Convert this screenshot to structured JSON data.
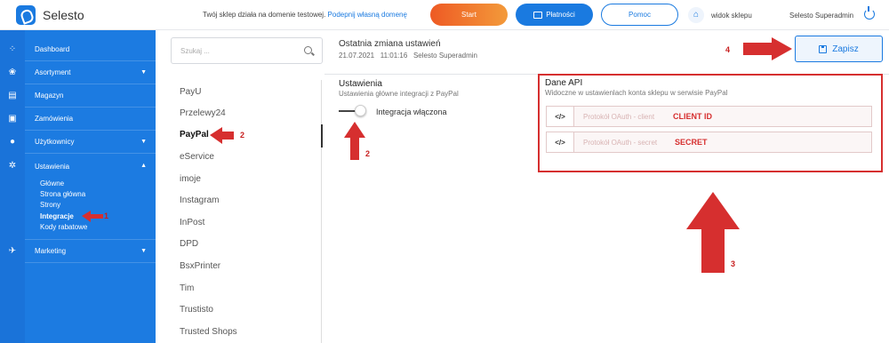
{
  "app": {
    "name": "Selesto",
    "notice": "Twój sklep działa na domenie testowej.",
    "notice_link": "Podepnij własną domenę"
  },
  "topbar": {
    "start_label": "Start",
    "payments_label": "Płatności",
    "help_label": "Pomoc",
    "view_shop_label": "widok sklepu",
    "user_label": "Selesto Superadmin"
  },
  "sidebar": {
    "items": [
      {
        "label": "Dashboard",
        "icon": "dashboard-icon"
      },
      {
        "label": "Asortyment",
        "icon": "assortment-icon",
        "caret": "▼"
      },
      {
        "label": "Magazyn",
        "icon": "warehouse-icon"
      },
      {
        "label": "Zamówienia",
        "icon": "orders-icon"
      },
      {
        "label": "Użytkownicy",
        "icon": "users-icon",
        "caret": "▼"
      },
      {
        "label": "Ustawienia",
        "icon": "settings-icon",
        "caret": "▲"
      },
      {
        "label": "Marketing",
        "icon": "marketing-icon",
        "caret": "▼"
      }
    ],
    "settings_sub": [
      "Główne",
      "Strona główna",
      "Strony",
      "Integracje",
      "Kody rabatowe"
    ],
    "active_sub": "Integracje"
  },
  "integrations": {
    "search_placeholder": "Szukaj ...",
    "items": [
      "PayU",
      "Przelewy24",
      "PayPal",
      "eService",
      "imoje",
      "Instagram",
      "InPost",
      "DPD",
      "BsxPrinter",
      "Tim",
      "Trustisto",
      "Trusted Shops"
    ],
    "active": "PayPal"
  },
  "main": {
    "last_change_title": "Ostatnia zmiana ustawień",
    "last_change_date": "21.07.2021",
    "last_change_time": "11:01:16",
    "last_change_user": "Selesto Superadmin",
    "save_label": "Zapisz",
    "settings_title": "Ustawienia",
    "settings_subtitle": "Ustawienia główne integracji z PayPal",
    "toggle_label": "Integracja włączona",
    "toggle_on": true,
    "api_title": "Dane API",
    "api_subtitle": "Widoczne w ustawienlach konta sklepu w serwisie PayPal",
    "fields": [
      {
        "addon": "</>",
        "placeholder": "Protokół OAuth - client",
        "tag": "CLIENT ID"
      },
      {
        "addon": "</>",
        "placeholder": "Protokół OAuth - secret",
        "tag": "SECRET"
      }
    ]
  },
  "annotations": {
    "n1": "1",
    "n2a": "2",
    "n2b": "2",
    "n3": "3",
    "n4": "4"
  },
  "colors": {
    "primary": "#1a7ae0",
    "sidebar": "#1c7be1",
    "annotation_red": "#d62f2f",
    "start_orange": "#ee5a24"
  }
}
